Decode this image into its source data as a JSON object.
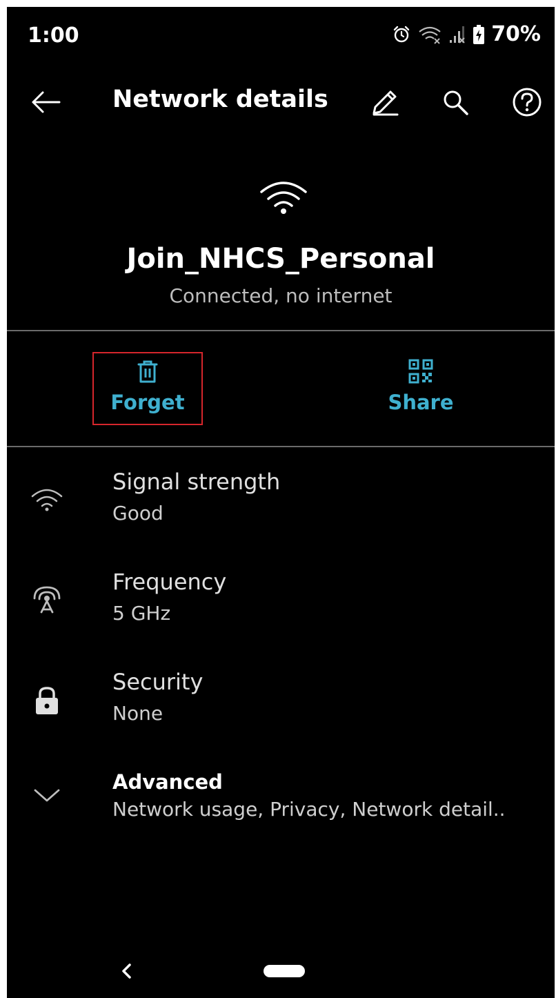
{
  "status_bar": {
    "time": "1:00",
    "battery": "70%",
    "icons": [
      "alarm-icon",
      "wifi-no-internet-icon",
      "signal-no-service-icon",
      "battery-charging-icon"
    ]
  },
  "app_bar": {
    "title": "Network details",
    "back_icon": "arrow-back-icon",
    "actions": [
      "edit-pencil-icon",
      "search-icon",
      "help-icon"
    ]
  },
  "network": {
    "icon": "wifi-icon",
    "name": "Join_NHCS_Personal",
    "status": "Connected, no internet"
  },
  "actions": [
    {
      "label": "Forget",
      "icon": "trash-icon",
      "highlighted": true
    },
    {
      "label": "Share",
      "icon": "qr-code-icon"
    }
  ],
  "details": [
    {
      "title": "Signal strength",
      "value": "Good",
      "icon": "wifi-signal-icon"
    },
    {
      "title": "Frequency",
      "value": "5 GHz",
      "icon": "antenna-icon"
    },
    {
      "title": "Security",
      "value": "None",
      "icon": "lock-icon"
    },
    {
      "title": "Advanced",
      "value": "Network usage, Privacy, Network detail..",
      "icon": "chevron-down-icon"
    }
  ],
  "colors": {
    "background": "#000000",
    "accent": "#3fb0cf",
    "highlight_border": "#d6262c",
    "divider": "#6b6b6b"
  },
  "nav_bar": {
    "back_icon": "nav-back-icon",
    "home_icon": "home-pill-icon"
  }
}
